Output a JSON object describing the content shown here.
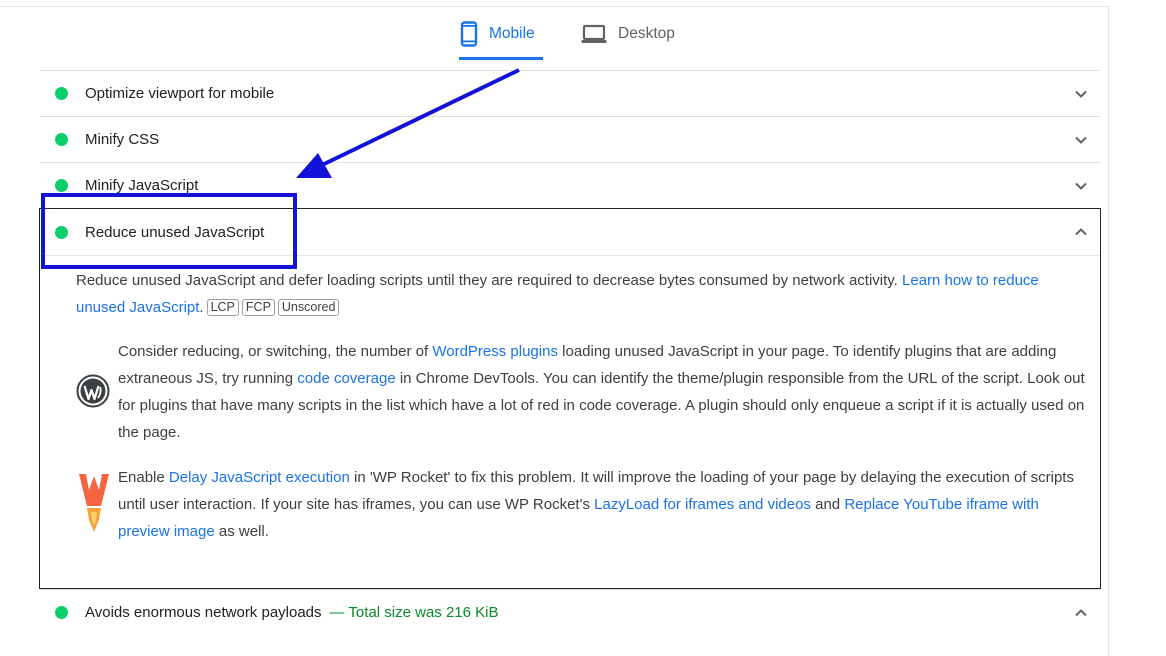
{
  "tabs": [
    {
      "label": "Mobile",
      "icon": "phone-icon",
      "active": true
    },
    {
      "label": "Desktop",
      "icon": "laptop-icon",
      "active": false
    }
  ],
  "audits": [
    {
      "title": "Optimize viewport for mobile",
      "status": "pass"
    },
    {
      "title": "Minify CSS",
      "status": "pass"
    },
    {
      "title": "Minify JavaScript",
      "status": "pass"
    }
  ],
  "expanded_audit": {
    "title": "Reduce unused JavaScript",
    "status": "pass",
    "description": "Reduce unused JavaScript and defer loading scripts until they are required to decrease bytes consumed by network activity.",
    "learn_link": "Learn how to reduce unused JavaScript",
    "chips": [
      "LCP",
      "FCP",
      "Unscored"
    ],
    "wordpress_stack": {
      "icon": "wordpress-icon",
      "text_1": "Consider reducing, or switching, the number of",
      "link_1": "WordPress plugins",
      "text_2": "loading unused JavaScript in your page. To identify plugins that are adding extraneous JS, try running",
      "link_2": "code coverage",
      "text_3": "in Chrome DevTools. You can identify the theme/plugin responsible from the URL of the script. Look out for plugins that have many scripts in the list which have a lot of red in code coverage. A plugin should only enqueue a script if it is actually used on the page."
    },
    "wprocket_stack": {
      "icon": "wp-rocket-icon",
      "text_1": "Enable",
      "link_1": "Delay JavaScript execution",
      "text_2": "in 'WP Rocket' to fix this problem. It will improve the loading of your page by delaying the execution of scripts until user interaction. If your site has iframes, you can use WP Rocket's",
      "link_2": "LazyLoad for iframes and videos",
      "text_3": "and",
      "link_3": "Replace YouTube iframe with preview image",
      "text_4": "as well."
    }
  },
  "last_audit": {
    "title": "Avoids enormous network payloads",
    "detail": "— Total size was 216 KiB",
    "status": "pass"
  },
  "colors": {
    "pass": "#0cce6b",
    "link": "#1a73e8",
    "annotation": "#1212d8",
    "detail_green": "#0b8a28"
  }
}
